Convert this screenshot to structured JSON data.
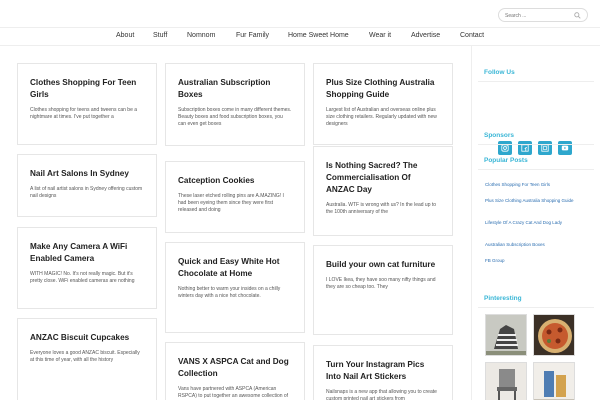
{
  "header": {
    "search_placeholder": "Search ..."
  },
  "nav": {
    "items": [
      "About",
      "Stuff",
      "Nomnom",
      "Fur Family",
      "Home Sweet Home",
      "Wear it",
      "Advertise",
      "Contact"
    ]
  },
  "posts": [
    {
      "title": "Clothes Shopping For Teen Girls",
      "excerpt": "Clothes shopping for teens and tweens can be a nightmare at times. I've put together a"
    },
    {
      "title": "Nail Art Salons In Sydney",
      "excerpt": "A list of nail artist salons in Sydney offering custom nail designs"
    },
    {
      "title": "Make Any Camera A WiFi Enabled Camera",
      "excerpt": "WITH MAGIC! No. It's not really magic. But it's pretty close. WiFi enabled cameras are nothing"
    },
    {
      "title": "ANZAC Biscuit Cupcakes",
      "excerpt": "Everyone loves a good ANZAC biscuit. Especially at this time of year, with all the history"
    },
    {
      "title": "Australian Subscription Boxes",
      "excerpt": "Subscription boxes come in many different themes. Beauty boxes and food subscription boxes, you can even get boxes"
    },
    {
      "title": "Catception Cookies",
      "excerpt": "These laser etched rolling pins are A.MAZING! I had been eyeing them since they were first released and doing"
    },
    {
      "title": "Quick and Easy White Hot Chocolate at Home",
      "excerpt": "Nothing better to warm your insides on a chilly winters day with a nice hot chocolate."
    },
    {
      "title": "VANS X ASPCA Cat and Dog Collection",
      "excerpt": "Vans have partnered with ASPCA (American RSPCA) to put together an awesome collection of kitty and"
    },
    {
      "title": "Plus Size Clothing Australia Shopping Guide",
      "excerpt": "Largest list of Australian and overseas online plus size clothing retailers. Regularly updated with new designers"
    },
    {
      "title": "Is Nothing Sacred? The Commercialisation Of ANZAC Day",
      "excerpt": "Australia. WTF is wrong with us? In the lead up to the 100th anniversary of the"
    },
    {
      "title": "Build your own cat furniture",
      "excerpt": "I LOVE Ikea, they have soo many nifty things and they are so cheap too. They"
    },
    {
      "title": "Turn Your Instagram Pics Into Nail Art Stickers",
      "excerpt": "Nailsnaps is a new app that allowing you to create custom printed nail art stickers from"
    }
  ],
  "sidebar": {
    "follow_title": "Follow Us",
    "social_icons": [
      "instagram-icon",
      "facebook-icon",
      "email-icon",
      "youtube-icon"
    ],
    "sponsors_title": "Sponsors",
    "popular_title": "Popular Posts",
    "popular_posts": [
      "Clothes Shopping For Teen Girls",
      "Plus Size Clothing Australia Shopping Guide",
      "Lifestyle Of A Crazy Cat And Dog Lady",
      "Australian Subscription Boxes",
      "FB Group"
    ],
    "pinteresting_title": "Pinteresting"
  },
  "colors": {
    "accent": "#39b6d6",
    "social_button": "#2ea7cd",
    "link": "#2a6db0",
    "card_border": "#e6e6e6"
  }
}
